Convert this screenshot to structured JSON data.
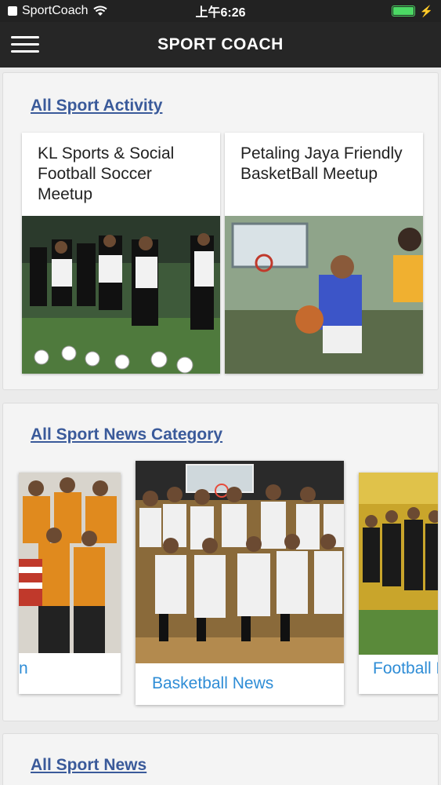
{
  "status": {
    "carrier": "SportCoach",
    "time": "上午6:26"
  },
  "appbar": {
    "title": "SPORT COACH"
  },
  "activity": {
    "section_title": "All Sport Activity",
    "cards": [
      {
        "title": "KL Sports & Social Football Soccer Meetup"
      },
      {
        "title": "Petaling Jaya Friendly BasketBall Meetup"
      }
    ]
  },
  "news_category": {
    "section_title": "All Sport News Category",
    "cards": [
      {
        "label": "n"
      },
      {
        "label": "Basketball News"
      },
      {
        "label": "Football N"
      }
    ]
  },
  "news": {
    "section_title": "All Sport News"
  },
  "colors": {
    "header": "#262626",
    "link": "#3a5a9a",
    "news_label": "#2f8dd6"
  }
}
